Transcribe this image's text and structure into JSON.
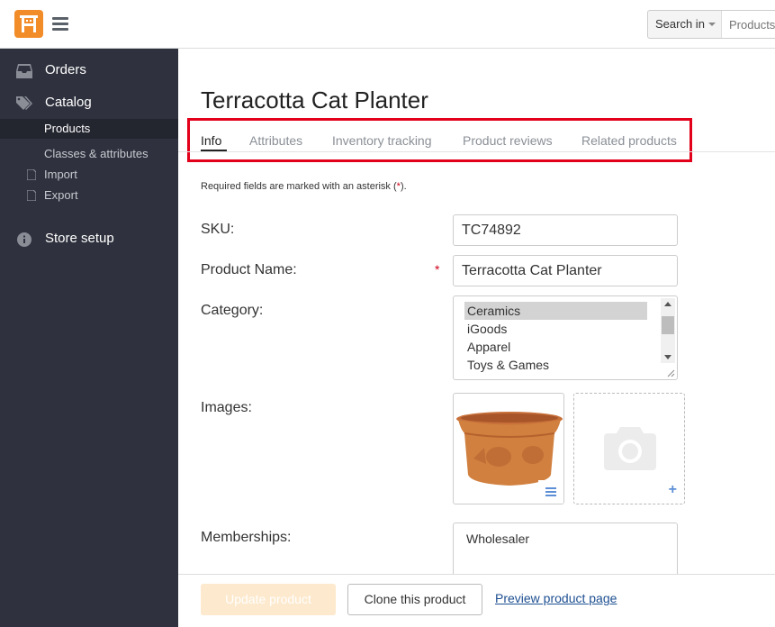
{
  "header": {
    "search_scope": "Search in",
    "search_placeholder": "Products"
  },
  "sidebar": {
    "orders": "Orders",
    "catalog": "Catalog",
    "catalog_items": [
      "Products",
      "Classes & attributes",
      "Import",
      "Export"
    ],
    "store_setup": "Store setup"
  },
  "page": {
    "title": "Terracotta Cat Planter",
    "tabs": [
      "Info",
      "Attributes",
      "Inventory tracking",
      "Product reviews",
      "Related products"
    ],
    "active_tab": "Info",
    "required_note_prefix": "Required fields are marked with an asterisk (",
    "required_note_star": "*",
    "required_note_suffix": ")."
  },
  "form": {
    "sku_label": "SKU:",
    "sku_value": "TC74892",
    "name_label": "Product Name:",
    "name_required": "*",
    "name_value": "Terracotta Cat Planter",
    "category_label": "Category:",
    "categories": [
      "Ceramics",
      "iGoods",
      "Apparel",
      "Toys & Games"
    ],
    "selected_category": "Ceramics",
    "images_label": "Images:",
    "memberships_label": "Memberships:",
    "memberships_value": "Wholesaler"
  },
  "footer": {
    "update_label": "Update product",
    "clone_label": "Clone this product",
    "preview_label": "Preview product page"
  },
  "colors": {
    "brand": "#f28c28",
    "sidebar_bg": "#2f323e",
    "highlight": "#e3001b",
    "link": "#1d4f91"
  }
}
